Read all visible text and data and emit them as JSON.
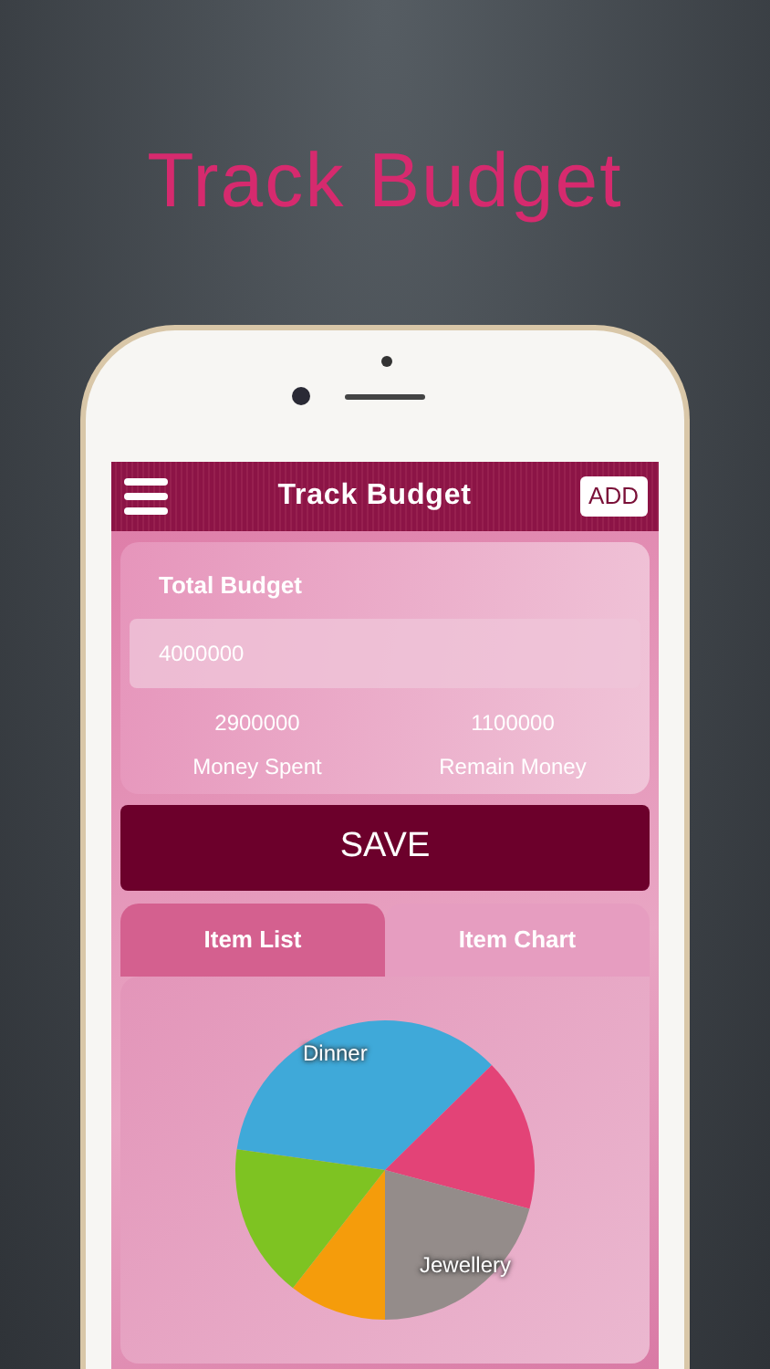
{
  "promo_title": "Track Budget",
  "app_bar": {
    "title": "Track Budget",
    "action": "ADD"
  },
  "budget_card": {
    "label": "Total Budget",
    "value": "4000000",
    "stats": [
      {
        "value": "2900000",
        "label": "Money Spent"
      },
      {
        "value": "1100000",
        "label": "Remain Money"
      }
    ]
  },
  "save_button": "SAVE",
  "tabs": [
    {
      "label": "Item List",
      "selected": false
    },
    {
      "label": "Item Chart",
      "selected": true
    }
  ],
  "pie_labels": [
    "Dinner",
    "Jewellery"
  ]
}
